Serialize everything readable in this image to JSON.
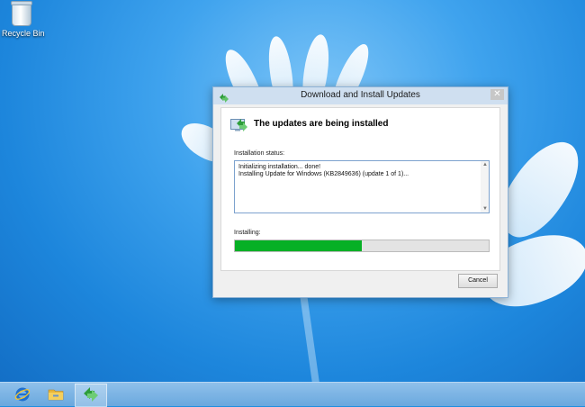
{
  "desktop": {
    "icons": [
      {
        "label": "Recycle Bin",
        "icon": "recycle-bin-icon"
      }
    ]
  },
  "dialog": {
    "title": "Download and Install Updates",
    "close_symbol": "✕",
    "heading": "The updates are being installed",
    "status_label": "Installation status:",
    "status_lines": [
      "Initializing installation... done!",
      "Installing Update for Windows (KB2849636) (update 1 of 1)..."
    ],
    "installing_label": "Installing:",
    "progress_percent": 50,
    "cancel_label": "Cancel"
  },
  "taskbar": {
    "items": [
      {
        "icon": "internet-explorer-icon"
      },
      {
        "icon": "file-explorer-icon"
      },
      {
        "icon": "windows-update-icon",
        "active": true
      }
    ]
  },
  "colors": {
    "progress": "#06b025",
    "desktop": "#1f8ee0",
    "titlebar": "#cfdff0"
  }
}
